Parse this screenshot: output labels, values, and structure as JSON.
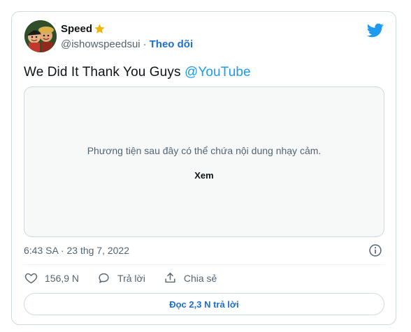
{
  "author": {
    "display_name": "Speed",
    "handle": "@ishowspeedsui",
    "follow_label": "Theo dõi",
    "badge_icon": "star-icon"
  },
  "tweet": {
    "text": "We Did It Thank You Guys ",
    "mention": "@YouTube"
  },
  "media": {
    "warning": "Phương tiện sau đây có thể chứa nội dung nhạy cảm.",
    "view_label": "Xem"
  },
  "meta": {
    "timestamp": "6:43 SA · 23 thg 7, 2022"
  },
  "actions": {
    "likes": "156,9 N",
    "reply_label": "Trả lời",
    "share_label": "Chia sẻ"
  },
  "replies_button": "Đọc 2,3 N trả lời",
  "colors": {
    "accent": "#1d9bf0",
    "link": "#1d6fd1",
    "muted": "#536471",
    "border": "#cfd9de",
    "star": "#f4b400"
  }
}
